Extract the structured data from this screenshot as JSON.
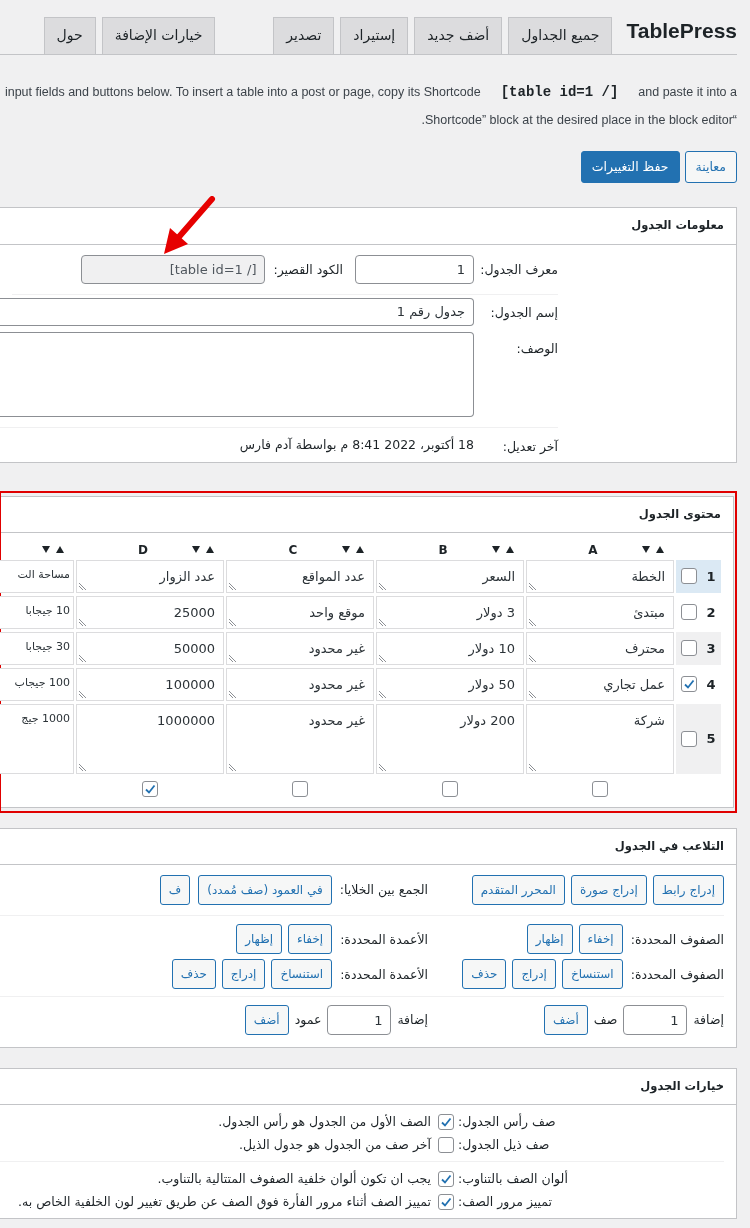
{
  "brand": "TablePress",
  "tabs": [
    {
      "label": "جميع الجداول"
    },
    {
      "label": "أضف جديد"
    },
    {
      "label": "إستيراد"
    },
    {
      "label": "تصدير"
    }
  ],
  "secondary_tabs": [
    {
      "label": "خيارات الإضافة"
    },
    {
      "label": "حول"
    }
  ],
  "intro": {
    "text_before": "input fields and buttons below. To insert a table into a post or page, copy its Shortcode",
    "shortcode": "[table id=1 /]",
    "text_after": "and paste it into a",
    "line2": "“Shortcode” block at the desired place in the block editor."
  },
  "actions": [
    {
      "label": "معاينة",
      "kind": "secondary"
    },
    {
      "label": "حفظ التغييرات",
      "kind": "primary"
    }
  ],
  "table_info": {
    "title": "معلومات الجدول",
    "id_label": "معرف الجدول:",
    "id_value": "1",
    "shortcode_label": "الكود القصير:",
    "shortcode_value": "[table id=1 /]",
    "name_label": "إسم الجدول:",
    "name_value": "جدول رقم 1",
    "description_label": "الوصف:",
    "modified_label": "آخر تعديل:",
    "modified_value": "18 أكتوبر، 2022 8:41 م بواسطة آدم فارس"
  },
  "table_content": {
    "title": "محتوى الجدول",
    "columns": [
      {
        "letter": "A",
        "checked": false
      },
      {
        "letter": "B",
        "checked": false
      },
      {
        "letter": "C",
        "checked": false
      },
      {
        "letter": "D",
        "checked": true
      },
      {}
    ],
    "rows": [
      {
        "number": "1",
        "checked": false,
        "highlighted": true,
        "tall": false,
        "cells": [
          "الخطة",
          "السعر",
          "عدد المواقع",
          "عدد الزوار",
          "مساحة الت"
        ]
      },
      {
        "number": "2",
        "checked": false,
        "highlighted": false,
        "tall": false,
        "cells": [
          "مبتدئ",
          "3 دولار",
          "موقع واحد",
          "25000",
          "10 جيجابا"
        ]
      },
      {
        "number": "3",
        "checked": false,
        "highlighted": false,
        "tall": false,
        "cells": [
          "محترف",
          "10 دولار",
          "غير محدود",
          "50000",
          "30 جيجابا"
        ]
      },
      {
        "number": "4",
        "checked": true,
        "highlighted": false,
        "tall": false,
        "cells": [
          "عمل تجاري",
          "50 دولار",
          "غير محدود",
          "100000",
          "100 جيجاب"
        ]
      },
      {
        "number": "5",
        "checked": false,
        "highlighted": false,
        "tall": true,
        "cells": [
          "شركة",
          "200 دولار",
          "غير محدود",
          "1000000",
          "1000 جيج"
        ]
      }
    ]
  },
  "manipulation": {
    "title": "التلاعب في الجدول",
    "insert_buttons": [
      "إدراج رابط",
      "إدراج صورة",
      "المحرر المتقدم"
    ],
    "merge_label": "الجمع بين الخلايا:",
    "merge_buttons": [
      "في العمود (صف مُمدد)",
      "ف"
    ],
    "rows_visibility": {
      "label": "الصفوف المحددة:",
      "buttons": [
        "إخفاء",
        "إظهار"
      ]
    },
    "columns_visibility": {
      "label": "الأعمدة المحددة:",
      "buttons": [
        "إخفاء",
        "إظهار"
      ]
    },
    "rows_edit": {
      "label": "الصفوف المحددة:",
      "buttons": [
        "استنساخ",
        "إدراج",
        "حذف"
      ]
    },
    "columns_edit": {
      "label": "الأعمدة المحددة:",
      "buttons": [
        "استنساخ",
        "إدراج",
        "حذف"
      ]
    },
    "add_rows": {
      "label": "إضافة",
      "value": "1",
      "unit": "صف",
      "button": "أضف"
    },
    "add_columns": {
      "label": "إضافة",
      "value": "1",
      "unit": "عمود",
      "button": "أضف"
    }
  },
  "options": {
    "title": "خيارات الجدول",
    "groups": [
      [
        {
          "label": "صف رأس الجدول:",
          "checked": true,
          "text": "الصف الأول من الجدول هو رأس الجدول."
        },
        {
          "label": "صف ذيل الجدول:",
          "checked": false,
          "text": "آخر صف من الجدول هو جدول الذيل."
        }
      ],
      [
        {
          "label": "ألوان الصف بالتناوب:",
          "checked": true,
          "text": "يجب ان تكون ألوان خلفية الصفوف المتتالية بالتناوب."
        },
        {
          "label": "تمييز مرور الصف:",
          "checked": true,
          "text": "تمييز الصف أثناء مرور الفأرة فوق الصف عن طريق تغيير لون الخلفية الخاص به."
        }
      ]
    ]
  }
}
